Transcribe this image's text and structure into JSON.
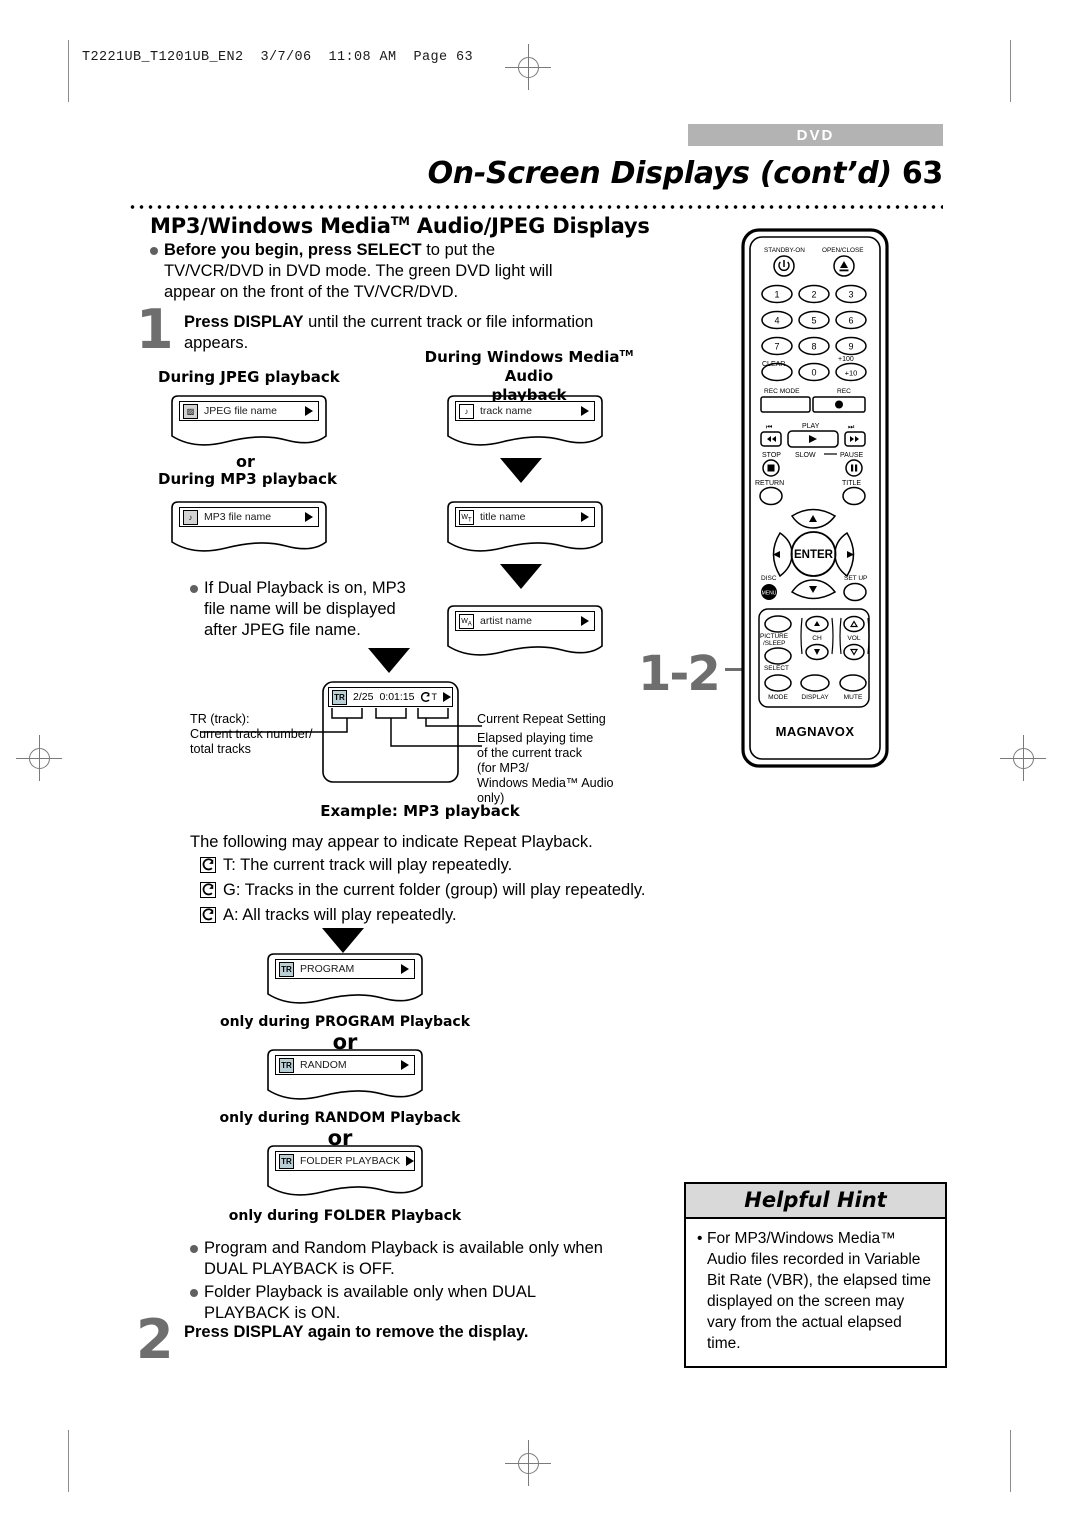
{
  "printer": {
    "slug": "T2221UB_T1201UB_EN2  3/7/06  11:08 AM  Page 63"
  },
  "header": {
    "tab": "DVD",
    "title": "On-Screen Displays (cont’d)",
    "page_number": "63",
    "section_title_parts": {
      "a": "MP3/Windows Media",
      "tm": "TM",
      "b": " Audio/JPEG Displays"
    }
  },
  "before": {
    "bold": "Before you begin, press SELECT",
    "rest": " to put the TV/VCR/DVD in DVD mode. The green DVD light will appear on the front of the TV/VCR/DVD."
  },
  "steps": [
    {
      "number": "1",
      "bold": "Press DISPLAY",
      "rest": " until the current track or file information appears."
    },
    {
      "number": "2",
      "bold": "Press DISPLAY again to remove the display.",
      "rest": ""
    }
  ],
  "marker": {
    "label": "1-2"
  },
  "labels": {
    "jpeg_playback": "During JPEG playback",
    "or_small": "or",
    "mp3_playback": "During MP3 playback",
    "wma_playback_line1": "During Windows Media",
    "wma_playback_tm": "TM",
    "wma_playback_line1b": " Audio",
    "wma_playback_line2": "playback"
  },
  "osd_boxes": {
    "jpeg": {
      "icon": "jpeg-file-icon",
      "text": "JPEG file name"
    },
    "mp3": {
      "icon": "mp3-file-icon",
      "text": "MP3 file name"
    },
    "track": {
      "icon": "music-note-icon",
      "text": "track name"
    },
    "title": {
      "icon": "wma-title-icon",
      "text": "title name"
    },
    "artist": {
      "icon": "wma-artist-icon",
      "text": "artist name"
    },
    "program": {
      "icon": "tr-icon",
      "text": "PROGRAM"
    },
    "random": {
      "icon": "tr-icon",
      "text": "RANDOM"
    },
    "folder": {
      "icon": "tr-icon",
      "text": "FOLDER PLAYBACK"
    }
  },
  "tr_display": {
    "icon": "TR",
    "track_counter": "2/25",
    "elapsed": "0:01:15",
    "repeat_flag": "T",
    "example_caption": "Example: MP3 playback"
  },
  "dual_note": {
    "text": "If Dual Playback is on, MP3 file name will be displayed after JPEG file name."
  },
  "callouts": {
    "left": "TR (track):\nCurrent track number/\ntotal tracks",
    "right_top": "Current Repeat Setting",
    "right_bottom": "Elapsed playing time\nof the current track\n(for MP3/\nWindows Media™ Audio\nonly)"
  },
  "repeat_section": {
    "heading": "The following may appear to indicate Repeat Playback.",
    "items": [
      {
        "flag": "T",
        "text": ": The current track will play repeatedly."
      },
      {
        "flag": "G",
        "text": ": Tracks in the current folder (group) will play repeatedly."
      },
      {
        "flag": "A",
        "text": ": All tracks will play repeatedly."
      }
    ]
  },
  "mode_captions": {
    "program": "only during PROGRAM Playback",
    "random": "only during RANDOM Playback",
    "folder": "only during FOLDER Playback",
    "or": "or"
  },
  "notes": [
    "Program and Random Playback is available only when DUAL PLAYBACK is OFF.",
    "Folder Playback is available only when DUAL PLAYBACK is ON."
  ],
  "helpful_hint": {
    "title": "Helpful Hint",
    "body": "For MP3/Windows Media™ Audio files recorded in Variable Bit Rate (VBR), the elapsed time displayed on the screen may vary from the actual elapsed time."
  },
  "remote": {
    "brand": "MAGNAVOX",
    "buttons": {
      "standby": "STANDBY-ON",
      "open_close": "OPEN/CLOSE",
      "numbers": [
        "1",
        "2",
        "3",
        "4",
        "5",
        "6",
        "7",
        "8",
        "9"
      ],
      "clear": "CLEAR",
      "zero": "0",
      "plus100": "+100",
      "plus10": "+10",
      "rec_mode": "REC MODE",
      "rec": "REC",
      "play": "PLAY",
      "stop": "STOP",
      "slow": "SLOW",
      "pause": "PAUSE",
      "return": "RETURN",
      "title": "TITLE",
      "enter": "ENTER",
      "disc": "DISC",
      "disc_menu": "MENU",
      "setup": "SET UP",
      "picture_sleep_1": "PICTURE",
      "picture_sleep_2": "/SLEEP",
      "select": "SELECT",
      "ch": "CH",
      "vol": "VOL",
      "mode": "MODE",
      "display": "DISPLAY",
      "mute": "MUTE"
    }
  },
  "colors": {
    "accent_gray": "#6e6e6e",
    "tab_gray": "#b3b3b3",
    "hint_head": "#d9d9d9"
  }
}
